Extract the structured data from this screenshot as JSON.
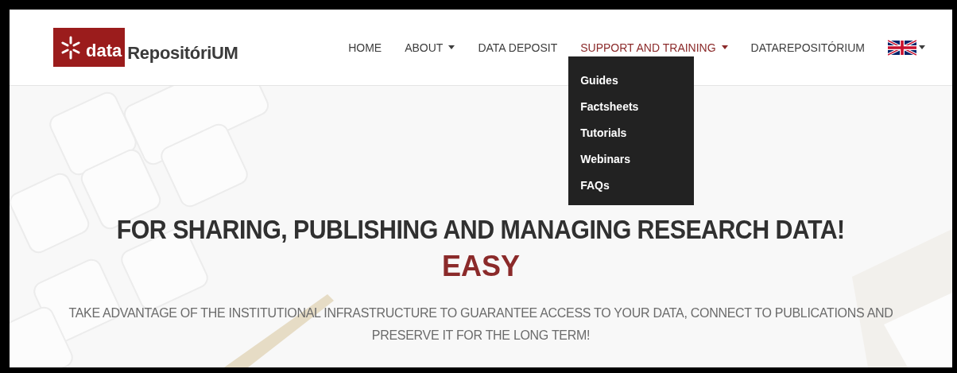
{
  "logo": {
    "prefix": "data",
    "name": "RepositóriUM"
  },
  "nav": [
    {
      "label": "HOME",
      "selected": false,
      "dropdown": false
    },
    {
      "label": "ABOUT",
      "selected": false,
      "dropdown": true
    },
    {
      "label": "DATA DEPOSIT",
      "selected": false,
      "dropdown": false
    },
    {
      "label": "SUPPORT AND TRAINING",
      "selected": true,
      "dropdown": true,
      "expanded": true,
      "menu": [
        "Guides",
        "Factsheets",
        "Tutorials",
        "Webinars",
        "FAQs"
      ]
    },
    {
      "label": "DATAREPOSITÓRIUM",
      "selected": false,
      "dropdown": false
    }
  ],
  "hero": {
    "kind": "picture",
    "headline": "FOR SHARING, PUBLISHING AND MANAGING RESEARCH DATA!",
    "highlight": "EASY",
    "subtitle": "TAKE ADVANTAGE OF THE INSTITUTIONAL INFRASTRUCTURE TO GUARANTEE ACCESS TO YOUR DATA, CONNECT TO PUBLICATIONS AND PRESERVE IT FOR THE LONG TERM!"
  }
}
